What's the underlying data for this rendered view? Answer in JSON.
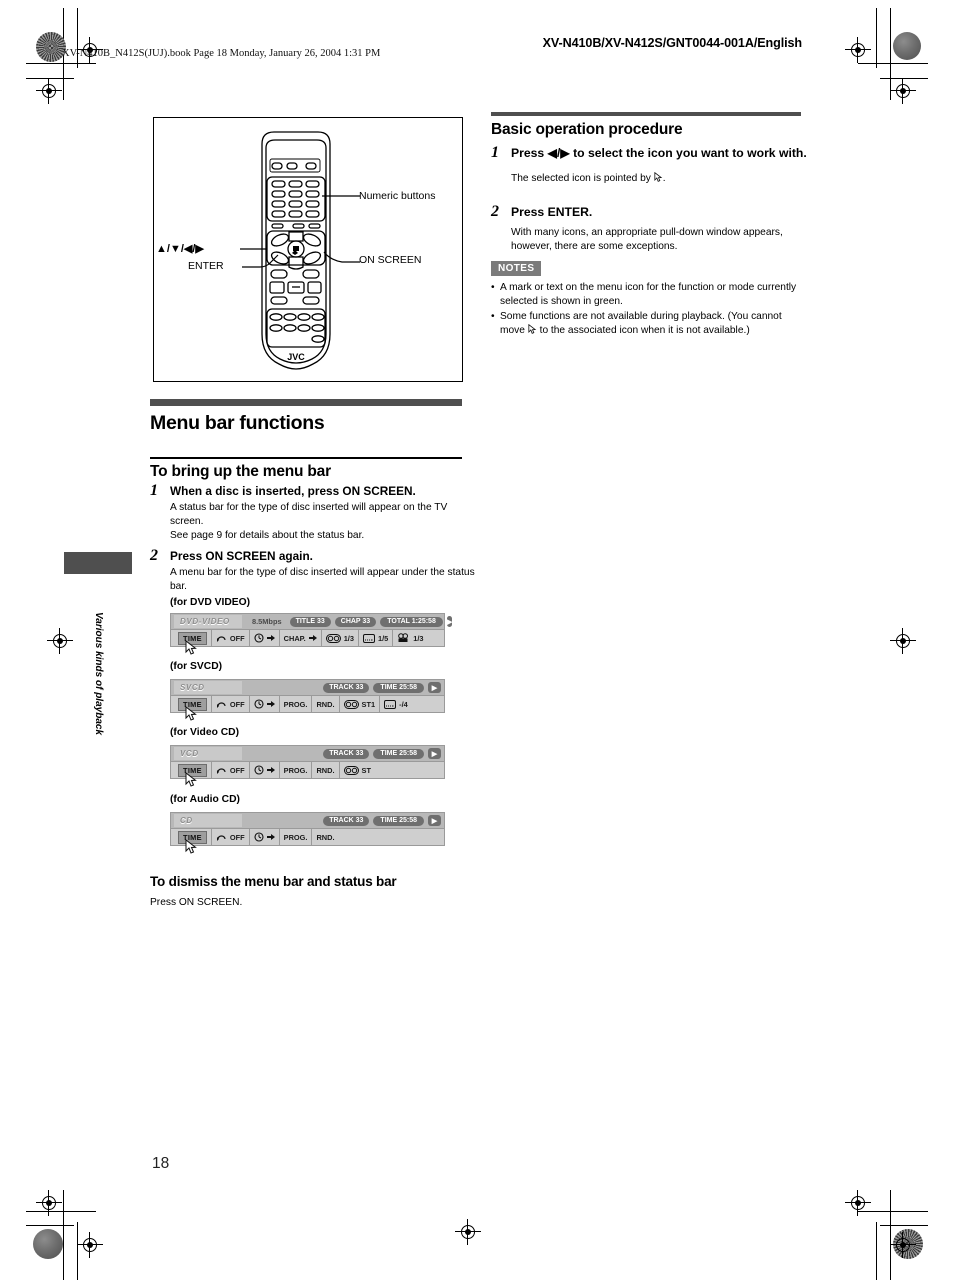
{
  "header": {
    "book_line": "XV-N410B_N412S(JUJ).book  Page 18  Monday, January 26, 2004  1:31 PM",
    "doc_id": "XV-N410B/XV-N412S/GNT0044-001A/English"
  },
  "figure": {
    "callouts": [
      {
        "name": "numeric-buttons",
        "label": "Numeric buttons"
      },
      {
        "name": "cursor-keys",
        "label": "▲/▼/◀/▶"
      },
      {
        "name": "enter",
        "label": "ENTER"
      },
      {
        "name": "on-screen",
        "label": "ON SCREEN"
      }
    ],
    "brand": "JVC"
  },
  "left": {
    "section_title": "Menu bar functions",
    "subsection_title": "To bring up the menu bar",
    "step1": {
      "num": "1",
      "head": "When a disc is inserted, press ON SCREEN.",
      "body": "A status bar for the type of disc inserted will appear on the TV screen.\nSee page 9 for details about the status bar."
    },
    "step2": {
      "num": "2",
      "head": "Press ON SCREEN again.",
      "body": "A menu bar for the type of disc inserted will appear under the status bar."
    },
    "captions": {
      "dvd": "(for DVD VIDEO)",
      "svcd": "(for SVCD)",
      "vcd": "(for Video CD)",
      "cd": "(for Audio CD)"
    },
    "dismiss_title": "To dismiss the menu bar and status bar",
    "dismiss_body": "Press ON SCREEN."
  },
  "menubars": {
    "dvd": {
      "disc": "DVD-VIDEO",
      "rate": "8.5Mbps",
      "pills": [
        "TITLE 33",
        "CHAP 33",
        "TOTAL 1:25:58"
      ],
      "play_icon": "▶",
      "items": [
        {
          "name": "time",
          "label": "TIME",
          "kind": "button"
        },
        {
          "name": "repeat-off",
          "label": "OFF",
          "icon": "repeat-icon"
        },
        {
          "name": "time-search",
          "label": "",
          "icon": "clock-arrow-icon"
        },
        {
          "name": "chapter-search",
          "label": "CHAP.",
          "icon": "arrow-icon"
        },
        {
          "name": "audio",
          "label": "1/3",
          "icon": "audio-icon"
        },
        {
          "name": "subtitle",
          "label": "1/5",
          "icon": "subtitle-icon"
        },
        {
          "name": "angle",
          "label": "1/3",
          "icon": "angle-icon"
        }
      ]
    },
    "svcd": {
      "disc": "SVCD",
      "rate": "",
      "pills": [
        "TRACK 33",
        "TIME    25:58"
      ],
      "play_icon": "▶",
      "items": [
        {
          "name": "time",
          "label": "TIME",
          "kind": "button"
        },
        {
          "name": "repeat-off",
          "label": "OFF",
          "icon": "repeat-icon"
        },
        {
          "name": "time-search",
          "label": "",
          "icon": "clock-arrow-icon"
        },
        {
          "name": "program",
          "label": "PROG.",
          "icon": ""
        },
        {
          "name": "random",
          "label": "RND.",
          "icon": ""
        },
        {
          "name": "audio",
          "label": "ST1",
          "icon": "audio-icon"
        },
        {
          "name": "subtitle",
          "label": "-/4",
          "icon": "subtitle-icon"
        }
      ]
    },
    "vcd": {
      "disc": "VCD",
      "rate": "",
      "pills": [
        "TRACK 33",
        "TIME    25:58"
      ],
      "play_icon": "▶",
      "items": [
        {
          "name": "time",
          "label": "TIME",
          "kind": "button"
        },
        {
          "name": "repeat-off",
          "label": "OFF",
          "icon": "repeat-icon"
        },
        {
          "name": "time-search",
          "label": "",
          "icon": "clock-arrow-icon"
        },
        {
          "name": "program",
          "label": "PROG.",
          "icon": ""
        },
        {
          "name": "random",
          "label": "RND.",
          "icon": ""
        },
        {
          "name": "audio",
          "label": "ST",
          "icon": "audio-icon"
        }
      ]
    },
    "cd": {
      "disc": "CD",
      "rate": "",
      "pills": [
        "TRACK 33",
        "TIME    25:58"
      ],
      "play_icon": "▶",
      "items": [
        {
          "name": "time",
          "label": "TIME",
          "kind": "button"
        },
        {
          "name": "repeat-off",
          "label": "OFF",
          "icon": "repeat-icon"
        },
        {
          "name": "time-search",
          "label": "",
          "icon": "clock-arrow-icon"
        },
        {
          "name": "program",
          "label": "PROG.",
          "icon": ""
        },
        {
          "name": "random",
          "label": "RND.",
          "icon": ""
        }
      ]
    }
  },
  "right": {
    "title": "Basic operation procedure",
    "step1": {
      "num": "1",
      "head": "Press ◀/▶ to select the icon you want to work with.",
      "body_before": "The selected icon is pointed by",
      "body_after": "."
    },
    "step2": {
      "num": "2",
      "head": "Press ENTER.",
      "body": "With many icons, an appropriate pull-down window appears, however, there are some exceptions."
    },
    "notes_label": "NOTES",
    "notes": [
      {
        "text": "A mark or text on the menu icon for the function or mode currently selected is shown in green."
      },
      {
        "text_before": "Some functions are not available during playback. (You cannot move",
        "text_after": "to the associated icon when it is not available.)"
      }
    ]
  },
  "sidetab": {
    "label": "Various kinds of playback"
  },
  "page_number": "18",
  "colors": {
    "rule": "#4f4f4f",
    "notes_badge": "#7b7b7b",
    "menubar_top": "#b8b8b8",
    "menubar_bottom": "#cfcfcf",
    "pill": "#6f6f6f"
  }
}
